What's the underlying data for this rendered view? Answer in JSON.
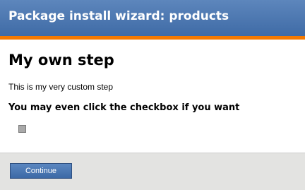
{
  "header": {
    "title": "Package install wizard: products"
  },
  "step": {
    "title": "My own step",
    "description": "This is my very custom step",
    "checkbox_label": "You may even click the checkbox if you want",
    "checkbox_checked": false
  },
  "footer": {
    "continue_label": "Continue"
  },
  "colors": {
    "header": "#4a76b0",
    "accent_bar": "#f57900",
    "footer": "#e3e3e1",
    "button": "#4a76b0"
  }
}
